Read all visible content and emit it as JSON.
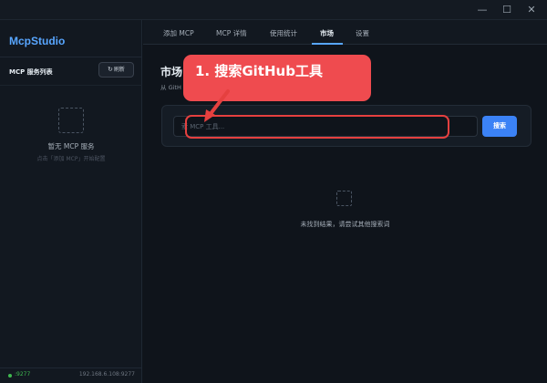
{
  "window": {
    "minimize_glyph": "—",
    "maximize_glyph": "☐",
    "close_glyph": "✕"
  },
  "sidebar": {
    "brand": "McpStudio",
    "list_title": "MCP 服务列表",
    "refresh_icon": "↻",
    "refresh_label": "刷新",
    "empty_title": "暂无 MCP 服务",
    "empty_subtitle": "点击「添加 MCP」开始配置",
    "footer": {
      "port": ":9277",
      "address": "192.168.6.108:9277",
      "status_color": "#3fb950"
    }
  },
  "tabs": [
    {
      "label": "添加 MCP",
      "active": false
    },
    {
      "label": "MCP 详情",
      "active": false
    },
    {
      "label": "使用统计",
      "active": false
    },
    {
      "label": "市场",
      "active": true
    },
    {
      "label": "设置",
      "active": false
    }
  ],
  "main": {
    "title": "市场",
    "subtitle": "从 GitH",
    "search": {
      "placeholder": "索 MCP 工具...",
      "button_label": "搜索"
    },
    "no_result": "未找到结果，请尝试其他搜索词"
  },
  "annotation": {
    "text": "1. 搜索GitHub工具",
    "color": "#ef4b4f"
  },
  "colors": {
    "accent": "#58a6ff",
    "button": "#3b82f6",
    "background": "#0f141b"
  }
}
